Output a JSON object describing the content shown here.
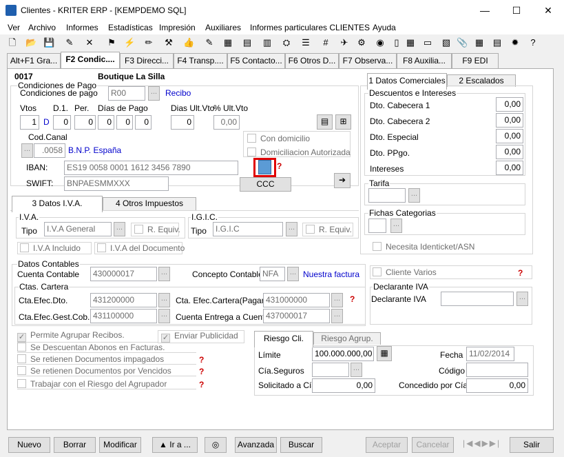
{
  "window": {
    "title": "Clientes - KRITER ERP - [KEMPDEMO SQL]",
    "minimize": "—",
    "maximize": "☐",
    "close": "✕"
  },
  "menu": [
    "Ver",
    "Archivo",
    "Informes",
    "Estadísticas",
    "Impresión",
    "Auxiliares",
    "Informes particulares CLIENTES",
    "Ayuda"
  ],
  "toolbar_icons": [
    "new-doc-icon",
    "open-folder-icon",
    "save-disk-icon",
    "edit-icon",
    "delete-x-icon",
    "tree-icon",
    "lightning-icon",
    "pencil-icon",
    "stamp-icon",
    "thumb-icon",
    "brush-icon",
    "table-icon",
    "calc-icon",
    "chart-icon",
    "toolbox-icon",
    "list-icon",
    "number-icon",
    "bird-icon",
    "tools-icon",
    "coins-icon",
    "vial-icon",
    "calendar-icon",
    "window-icon",
    "book-icon",
    "paperclip-icon",
    "grid-icon",
    "hierarchy-icon",
    "bulb-icon",
    "help-icon"
  ],
  "tabs": [
    "Alt+F1 Gra...",
    "F2 Condic....",
    "F3 Direcci...",
    "F4 Transp....",
    "F5 Contacto...",
    "F6 Otros D...",
    "F7 Observa...",
    "F8 Auxilia...",
    "F9 EDI"
  ],
  "header": {
    "code": "0017",
    "name": "Boutique La Silla"
  },
  "pago": {
    "group": "Condiciones de Pago",
    "cond_label": "Condiciones de pago",
    "cond_code": "R00",
    "cond_desc": "Recibo",
    "vtos_label": "Vtos",
    "d1_label": "D.1.",
    "per_label": "Per.",
    "dias_label": "Días de Pago",
    "dias_ult_label": "Dias Ult.Vto",
    "pct_label": "% Ult.Vto",
    "vtos": "1",
    "d": "D",
    "d1": "0",
    "per": "0",
    "dia1": "0",
    "dia2": "0",
    "dia3": "0",
    "dias_ult": "0",
    "pct": "0,00"
  },
  "banco": {
    "codcanal_label": "Cod.Canal",
    "codcanal": ".0058",
    "banco_name": "B.N.P. España",
    "iban_label": "IBAN:",
    "iban": "ES19 0058 0001 1612 3456 7890",
    "swift_label": "SWIFT:",
    "swift": "BNPAESMMXXX",
    "con_domicilio": "Con domicilio",
    "dom_aut": "Domiciliacion Autorizada",
    "ccc": "CCC"
  },
  "right_tabs": [
    "1 Datos Comerciales",
    "2 Escalados"
  ],
  "descuentos": {
    "group": "Descuentos e Intereses",
    "rows": [
      {
        "label": "Dto. Cabecera 1",
        "value": "0,00"
      },
      {
        "label": "Dto. Cabecera 2",
        "value": "0,00"
      },
      {
        "label": "Dto. Especial",
        "value": "0,00"
      },
      {
        "label": "Dto. PPgo.",
        "value": "0,00"
      },
      {
        "label": "Intereses",
        "value": "0,00"
      }
    ]
  },
  "tarifa": {
    "group": "Tarifa"
  },
  "fichas": {
    "group": "Fichas Categorias",
    "identicket": "Necesita Identicket/ASN"
  },
  "iva_tabs": [
    "3 Datos I.V.A.",
    "4 Otros Impuestos"
  ],
  "iva": {
    "group": "I.V.A.",
    "tipo_label": "Tipo",
    "tipo": "I.V.A General",
    "requiv": "R. Equiv.",
    "igic_group": "I.G.I.C.",
    "igic_tipo": "I.G.I.C",
    "iva_incl": "I.V.A Incluido",
    "iva_doc": "I.V.A del Documento"
  },
  "contables": {
    "group": "Datos Contables",
    "cuenta_label": "Cuenta Contable",
    "cuenta": "430000017",
    "concepto_label": "Concepto Contable",
    "concepto": "NFA",
    "concepto_desc": "Nuestra factura",
    "cartera_group": "Ctas. Cartera",
    "efec_dto_label": "Cta.Efec.Dto.",
    "efec_dto": "431200000",
    "efec_cart_label": "Cta. Efec.Cartera(Pagaré)",
    "efec_cart": "431000000",
    "gest_label": "Cta.Efec.Gest.Cob.",
    "gest": "431100000",
    "entrega_label": "Cuenta Entrega a Cuenta",
    "entrega": "437000017"
  },
  "varios": {
    "cliente_varios": "Cliente Varios",
    "decl_group": "Declarante IVA",
    "decl_label": "Declarante IVA"
  },
  "checks": {
    "agrupar": "Permite Agrupar Recibos.",
    "publicidad": "Enviar Publicidad",
    "abonos": "Se Descuentan Abonos en Facturas.",
    "impagados": "Se retienen Documentos impagados",
    "vencidos": "Se retienen Documentos por Vencidos",
    "riesgo_agr": "Trabajar con el Riesgo del Agrupador"
  },
  "riesgo": {
    "tab1": "Riesgo Cli.",
    "tab2": "Riesgo Agrup.",
    "limite_label": "Límite",
    "limite": "100.000.000,00",
    "fecha_label": "Fecha",
    "fecha": "11/02/2014",
    "seguros_label": "Cía.Seguros",
    "codigo_label": "Código",
    "solicitado_label": "Solicitado a Cía",
    "solicitado": "0,00",
    "concedido_label": "Concedido por Cía.",
    "concedido": "0,00"
  },
  "buttons": {
    "nuevo": "Nuevo",
    "borrar": "Borrar",
    "modificar": "Modificar",
    "ira": "▲ Ir a ...",
    "avanzada": "Avanzada",
    "buscar": "Buscar",
    "aceptar": "Aceptar",
    "cancelar": "Cancelar",
    "salir": "Salir"
  },
  "colors": {
    "highlight": "#e00000",
    "link": "#0000cc"
  }
}
